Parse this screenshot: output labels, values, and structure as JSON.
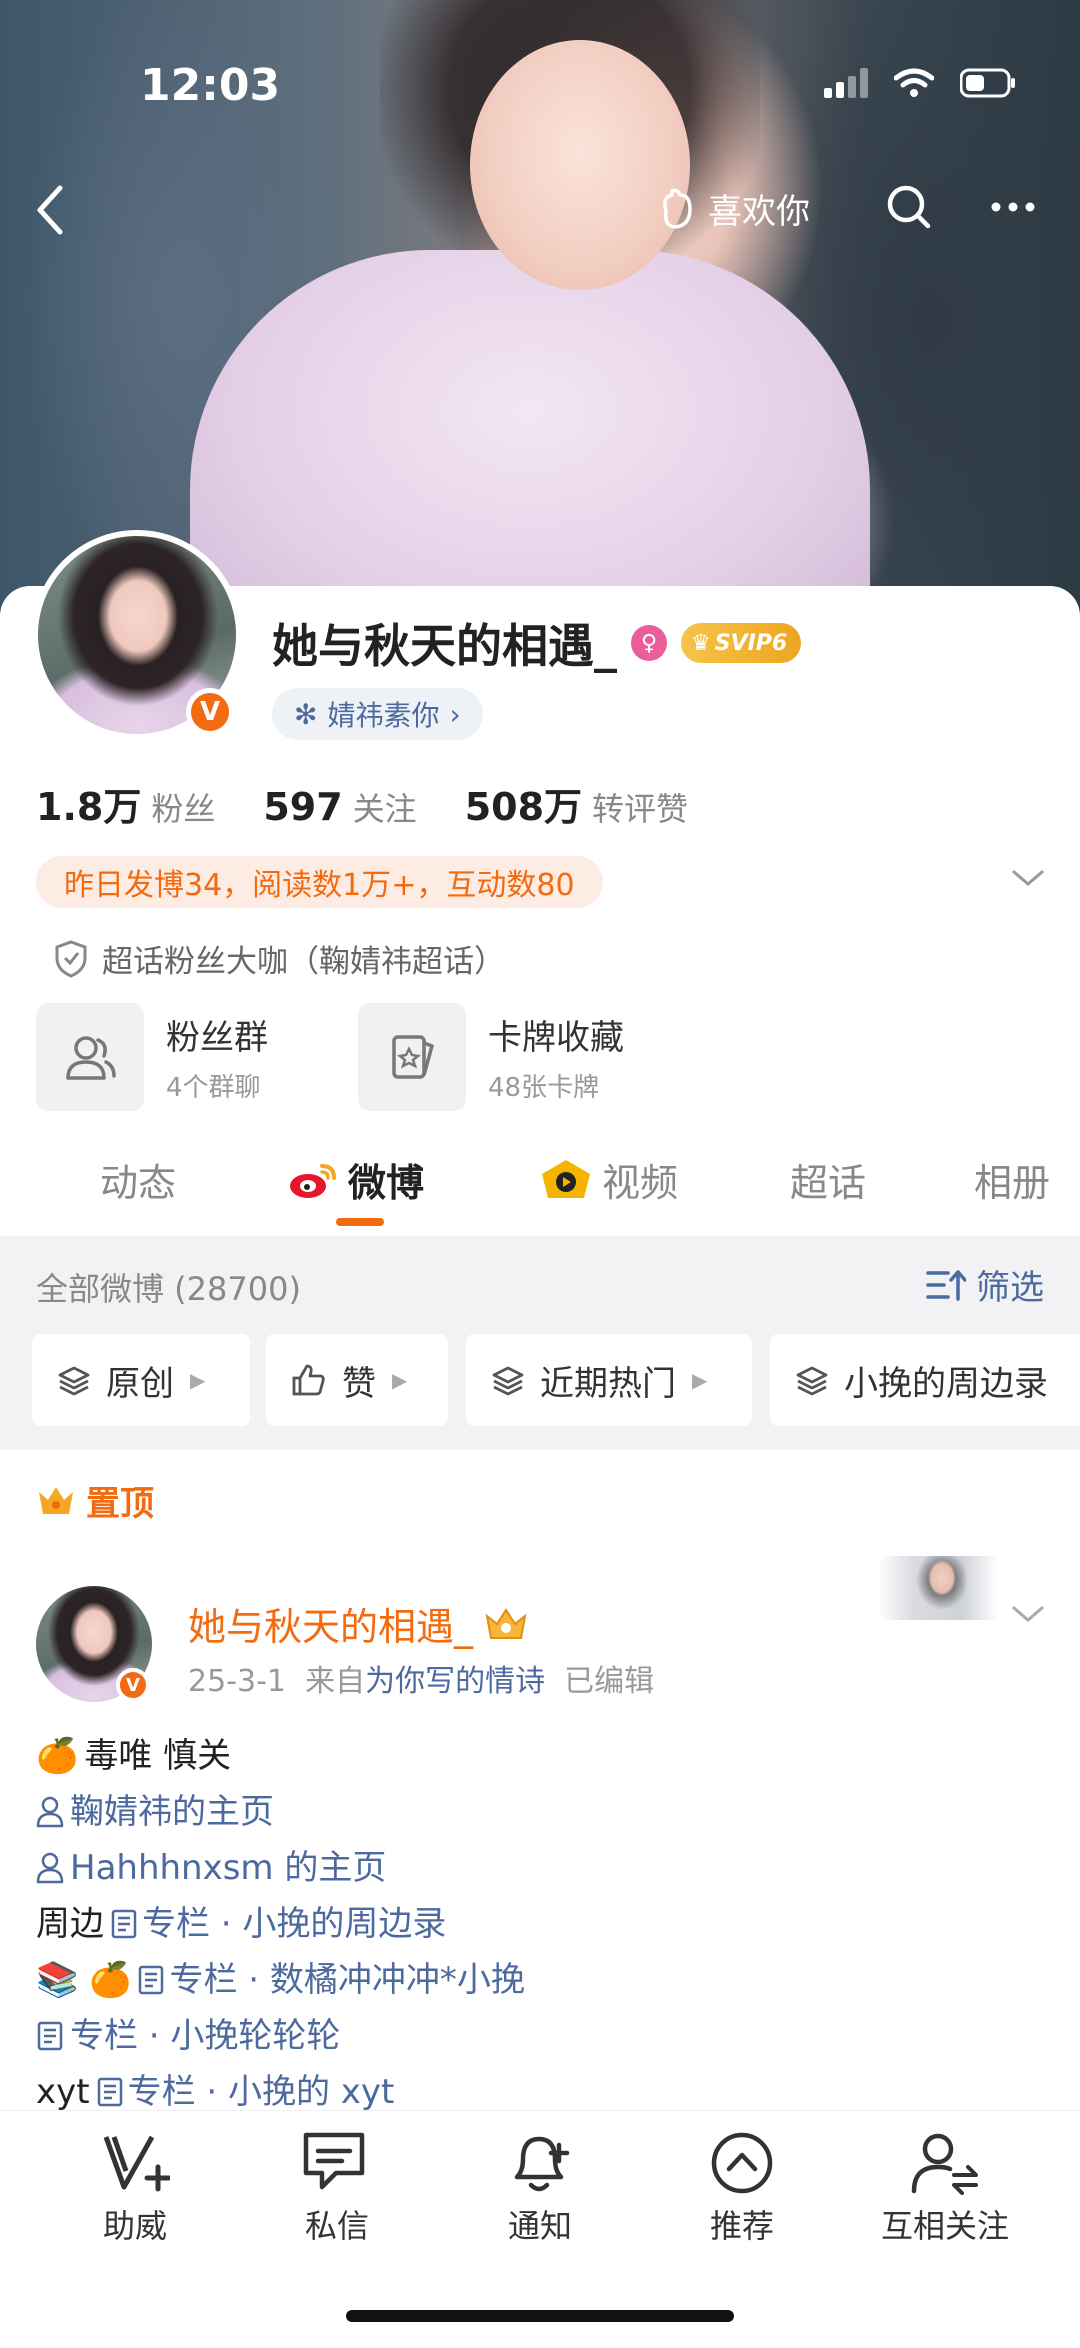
{
  "status_bar": {
    "time": "12:03"
  },
  "top_nav": {
    "like_label": "喜欢你"
  },
  "profile": {
    "name": "她与秋天的相遇_",
    "svip_label": "SVIP6",
    "tag_label": "婧祎素你",
    "stats": [
      {
        "num": "1.8万",
        "label": "粉丝"
      },
      {
        "num": "597",
        "label": "关注"
      },
      {
        "num": "508万",
        "label": "转评赞"
      }
    ],
    "activity": "昨日发博34，阅读数1万+，互动数80",
    "fan_title": "超话粉丝大咖（鞠婧祎超话）",
    "tiles": [
      {
        "title": "粉丝群",
        "sub": "4个群聊"
      },
      {
        "title": "卡牌收藏",
        "sub": "48张卡牌"
      }
    ]
  },
  "tabs": [
    "动态",
    "微博",
    "视频",
    "超话",
    "相册"
  ],
  "active_tab": "微博",
  "feed": {
    "all_count": "全部微博 (28700)",
    "filter_label": "筛选",
    "chips": [
      "原创",
      "赞",
      "近期热门",
      "小挽的周边录"
    ]
  },
  "post": {
    "pinned_label": "置顶",
    "author": "她与秋天的相遇_",
    "date": "25-3-1",
    "source_prefix": "来自",
    "source": "为你写的情诗",
    "edited": "已编辑",
    "lines": [
      {
        "emoji": "🍊",
        "text": "毒唯 慎关"
      },
      {
        "link": "鞠婧祎的主页"
      },
      {
        "link": "Hahhhnxsm 的主页"
      },
      {
        "prefix": "周边",
        "link": "专栏 · 小挽的周边录"
      },
      {
        "emoji": "📚 🍊",
        "link": "专栏 · 数橘冲冲冲*小挽"
      },
      {
        "link": "专栏 · 小挽轮轮轮"
      },
      {
        "prefix": "xyt",
        "link": "专栏 · 小挽的 xyt"
      }
    ]
  },
  "bottom_bar": [
    "助威",
    "私信",
    "通知",
    "推荐",
    "互相关注"
  ],
  "colors": {
    "accent": "#f26b10",
    "link": "#4c6a9e",
    "pink": "#ea5e9a",
    "gold": "#eea520"
  }
}
